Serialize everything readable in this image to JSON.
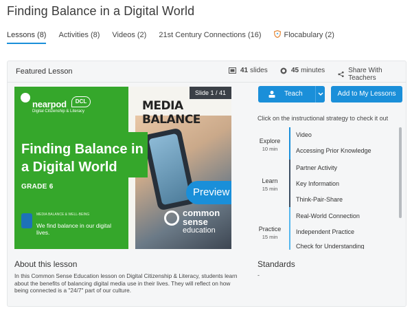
{
  "page": {
    "title": "Finding Balance in a Digital World"
  },
  "tabs": [
    {
      "label": "Lessons (8)",
      "active": true
    },
    {
      "label": "Activities (8)"
    },
    {
      "label": "Videos (2)"
    },
    {
      "label": "21st Century Connections (16)"
    },
    {
      "label": "Flocabulary (2)",
      "icon": "shield-icon"
    }
  ],
  "featured": {
    "heading": "Featured Lesson",
    "slides_count": "41",
    "slides_label": "slides",
    "minutes_count": "45",
    "minutes_label": "minutes",
    "share_label": "Share With Teachers"
  },
  "slide": {
    "badge": "Slide 1 / 41",
    "brand": "nearpod",
    "brand_badge": "DCL",
    "brand_sub": "Digital Citizenship & Literacy",
    "title": "Finding Balance in a Digital World",
    "grade": "GRADE 6",
    "kicker": "MEDIA BALANCE & WELL-BEING",
    "tagline": "We find balance in our digital lives.",
    "topic": "MEDIA BALANCE",
    "partner_line1": "common",
    "partner_line2": "sense",
    "partner_line3": "education",
    "preview_label": "Preview"
  },
  "actions": {
    "teach_label": "Teach",
    "add_label": "Add to My Lessons",
    "hint": "Click on the instructional strategy to check it out"
  },
  "phases": [
    {
      "name": "Explore",
      "duration": "10 min"
    },
    {
      "name": "Learn",
      "duration": "15 min"
    },
    {
      "name": "Practice",
      "duration": "15 min"
    }
  ],
  "strategies": [
    "Video",
    "Accessing Prior Knowledge",
    "Partner Activity",
    "Key Information",
    "Think-Pair-Share",
    "Real-World Connection",
    "Independent Practice",
    "Check for Understanding"
  ],
  "colors": {
    "accent": "#1a8fd9",
    "explore": "#1a8fd9",
    "learn": "#3b4e63",
    "practice": "#55b7ee",
    "slide_green": "#35a72b"
  },
  "about": {
    "heading": "About this lesson",
    "text": "In this Common Sense Education lesson on Digital Citizenship & Literacy, students learn about the benefits of balancing digital media use in their lives. They will reflect on how being connected is a \"24/7\" part of our culture."
  },
  "standards": {
    "heading": "Standards",
    "value": "-"
  }
}
